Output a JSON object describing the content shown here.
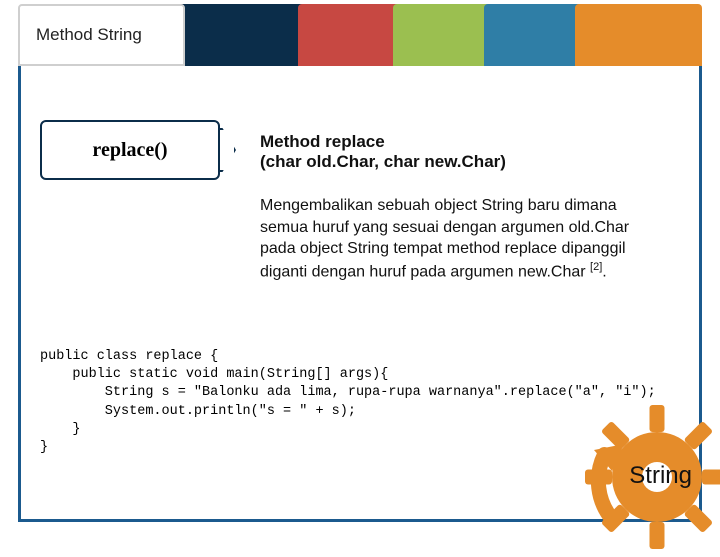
{
  "header": {
    "title": "Method String"
  },
  "pill": {
    "label": "replace()"
  },
  "content": {
    "heading_line1": "Method replace",
    "heading_line2": "(char old.Char, char new.Char)",
    "desc_p1": "Mengembalikan sebuah object String baru dimana semua huruf yang sesuai dengan argumen old.Char pada object String tempat method replace dipanggil diganti dengan huruf pada argumen new.Char ",
    "desc_ref": "[2]",
    "desc_p2": "."
  },
  "code": {
    "line1": "public class replace {",
    "line2": "    public static void main(String[] args){",
    "line3": "        String s = \"Balonku ada lima, rupa-rupa warnanya\".replace(\"a\", \"i\");",
    "line4": "        System.out.println(\"s = \" + s);",
    "line5": "    }",
    "line6": "}"
  },
  "badge": {
    "label": "String"
  },
  "colors": {
    "frame": "#1b5a8e",
    "navy": "#0b2d4a",
    "red": "#c74842",
    "green": "#9bbf50",
    "teal": "#2f7ea6",
    "orange": "#e58c2a"
  }
}
